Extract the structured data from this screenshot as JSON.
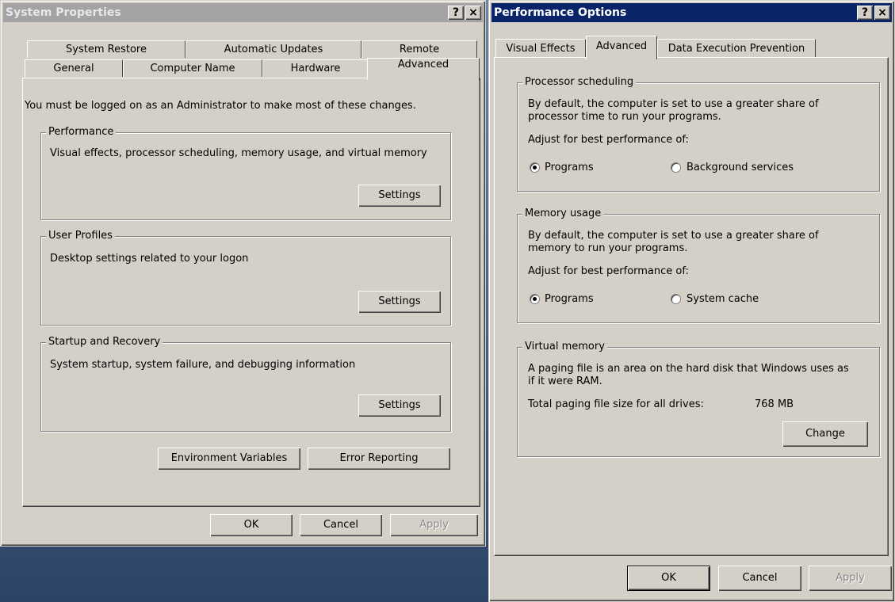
{
  "system_properties": {
    "title": "System Properties",
    "help_btn": "?",
    "close_btn": "×",
    "tabs_row1": [
      "System Restore",
      "Automatic Updates",
      "Remote"
    ],
    "tabs_row2": [
      "General",
      "Computer Name",
      "Hardware",
      "Advanced"
    ],
    "admin_note": "You must be logged on as an Administrator to make most of these changes.",
    "performance": {
      "legend": "Performance",
      "description": "Visual effects, processor scheduling, memory usage, and virtual memory",
      "button": "Settings"
    },
    "user_profiles": {
      "legend": "User Profiles",
      "description": "Desktop settings related to your logon",
      "button": "Settings"
    },
    "startup_recovery": {
      "legend": "Startup and Recovery",
      "description": "System startup, system failure, and debugging information",
      "button": "Settings"
    },
    "env_vars_button": "Environment Variables",
    "error_reporting_button": "Error Reporting",
    "ok": "OK",
    "cancel": "Cancel",
    "apply": "Apply"
  },
  "performance_options": {
    "title": "Performance Options",
    "help_btn": "?",
    "close_btn": "×",
    "tabs": [
      "Visual Effects",
      "Advanced",
      "Data Execution Prevention"
    ],
    "processor": {
      "legend": "Processor scheduling",
      "desc_line1": "By default, the computer is set to use a greater share of",
      "desc_line2": "processor time to run your programs.",
      "adjust": "Adjust for best performance of:",
      "opt1": "Programs",
      "opt2": "Background services"
    },
    "memory": {
      "legend": "Memory usage",
      "desc_line1": "By default, the computer is set to use a greater share of",
      "desc_line2": "memory to run your programs.",
      "adjust": "Adjust for best performance of:",
      "opt1": "Programs",
      "opt2": "System cache"
    },
    "virtual": {
      "legend": "Virtual memory",
      "desc_line1": "A paging file is an area on the hard disk that Windows uses as",
      "desc_line2": "if it were RAM.",
      "total_label": "Total paging file size for all drives:",
      "total_value": "768 MB",
      "change_button": "Change"
    },
    "ok": "OK",
    "cancel": "Cancel",
    "apply": "Apply"
  },
  "colors": {
    "active_title": "#0a246a",
    "inactive_title": "#a3a3a3",
    "face": "#d4d0c8"
  }
}
